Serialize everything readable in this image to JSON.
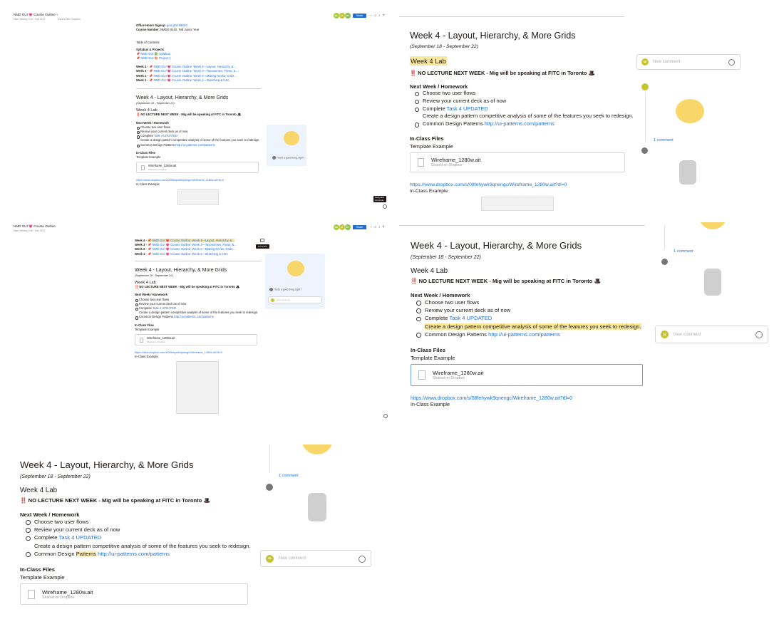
{
  "app": {
    "crumb": "Nwo Weekly Grit  ·  Fall 2017",
    "doc_title": "NMD GUI 💗 Course Outline",
    "saved": "Saved with Dropbox",
    "share_label": "Share",
    "avatars": [
      "SE",
      "JA",
      "MT"
    ]
  },
  "outline": {
    "office_label": "Office Hours Signup:",
    "office_val": "goo.gl/xH8kWG",
    "course_label": "Course Number:",
    "course_val": "NMDG 9102, Fall Junior Year",
    "toc_title": "Table of Contents",
    "syllabus_heading": "Syllabus & Projects",
    "toc_items": [
      "📌 NMD GUI 📗 Syllabus",
      "📌 NMD GUI 🎨 Project 1"
    ],
    "week_links": [
      {
        "label": "Week 4 -",
        "text": "📌 NMD GUI 💗 Course Outline: Week 4—Layout, Hierarchy, &..."
      },
      {
        "label": "Week 3 -",
        "text": "📌 NMD GUI 💗 Course Outline: Week 3—Taxonomies, Flows, &..."
      },
      {
        "label": "Week 2 -",
        "text": "📌 NMD GUI 💗 Course Outline: Week 2—Making Decks, Grids..."
      },
      {
        "label": "Week 1 -",
        "text": "📌 NMD GUI 💗 Course Outline: Week 1—Sketching & Intro"
      }
    ]
  },
  "week4": {
    "title": "Week 4 - Layout, Hierarchy, & More Grids",
    "dates": "(September 18 - September 22)",
    "lab": "Week 4 Lab",
    "no_lecture_icon": "‼️",
    "no_lecture": "NO LECTURE NEXT WEEK - Mig will be speaking at FITC in Toronto",
    "hat_icon": "🎩",
    "homework_heading": "Next Week / Homework",
    "items": {
      "flows": "Choose two user flows",
      "deck": "Review your current deck as of now",
      "complete": "Complete",
      "task_link": "Task 4 UPDATED",
      "analysis": "Create a design pattern competitive analysis of some of the features you seek to redesign.",
      "patterns_prefix": "Common Design",
      "patterns_word": "Patterns",
      "patterns_url": "http://ui-patterns.com/patterns"
    },
    "files_heading": "In-Class Files",
    "template_label": "Template Example",
    "file_name": "Wireframe_1280w.ait",
    "file_sub": "Shared on Dropbox",
    "dropbox_url": "https://www.dropbox.com/s/08fehywk9qnengc/Wireframe_1280w.ait?dl=0",
    "inclass_label": "In-Class Example"
  },
  "comments": {
    "placeholder": "New comment",
    "count": "1 comment",
    "text": "That's a good thing, right?",
    "tooltip": "Comment",
    "shortcut_tip": "Keyboard shortcuts"
  },
  "colors": {
    "accent_blue": "#1f6fd6",
    "highlight_yellow": "#fde79a",
    "avatar_green": "#a4cf3c",
    "avatar_olive": "#c7c431"
  }
}
